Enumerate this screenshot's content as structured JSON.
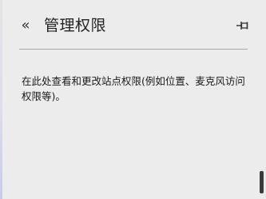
{
  "header": {
    "back_glyph": "«",
    "back_icon": "chevron-double-left-icon",
    "title": "管理权限",
    "pin_icon": "pin-icon"
  },
  "main": {
    "description": "在此处查看和更改站点权限(例如位置、麦克风访问权限等)。"
  },
  "colors": {
    "background": "#ececec",
    "divider": "#a8a8a8",
    "text": "#1a1a1a",
    "scrollbar_thumb": "#3c3c3c"
  }
}
